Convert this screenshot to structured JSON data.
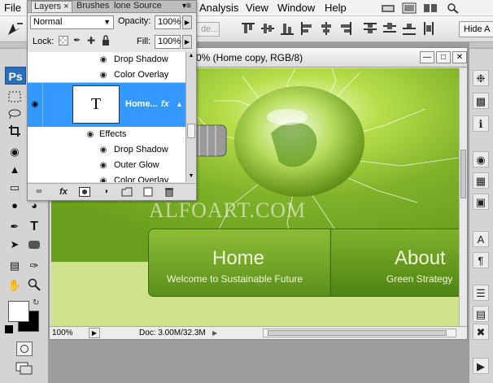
{
  "menubar": {
    "items": [
      "File",
      "Analysis",
      "View",
      "Window",
      "Help"
    ]
  },
  "optionsbar": {
    "hide_all_label": "Hide A",
    "truncated_label": "de..."
  },
  "layers_panel": {
    "tabs": [
      "Layers",
      "Brushes",
      "lone Source"
    ],
    "blend_mode": "Normal",
    "opacity_label": "Opacity:",
    "opacity_value": "100%",
    "lock_label": "Lock:",
    "fill_label": "Fill:",
    "fill_value": "100%",
    "rows": [
      {
        "label": "Drop Shadow",
        "type": "effect"
      },
      {
        "label": "Color Overlay",
        "type": "effect"
      },
      {
        "label": "Home...",
        "type": "layer",
        "thumb": "T",
        "selected": true
      },
      {
        "label": "Effects",
        "type": "group"
      },
      {
        "label": "Drop Shadow",
        "type": "effect"
      },
      {
        "label": "Outer Glow",
        "type": "effect"
      },
      {
        "label": "Color Overlay",
        "type": "effect"
      }
    ]
  },
  "toolbox": {
    "logo": "Ps"
  },
  "document": {
    "title": "0% (Home copy, RGB/8)",
    "zoom": "100%",
    "doc_size": "Doc: 3.00M/32.3M",
    "watermark": "ALFOART.COM",
    "nav": [
      {
        "title": "Home",
        "subtitle": "Welcome to Sustainable Future"
      },
      {
        "title": "About",
        "subtitle": "Green Strategy"
      }
    ]
  },
  "colors": {
    "selection": "#3399ff",
    "canvas_green": "#8fc23a",
    "light_green": "#cfe48a"
  }
}
